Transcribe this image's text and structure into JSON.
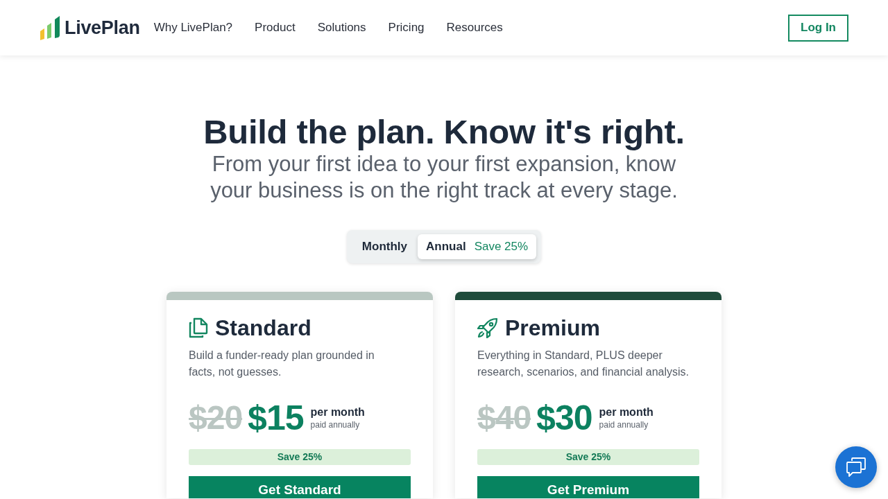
{
  "header": {
    "brand": "LivePlan",
    "nav": [
      "Why LivePlan?",
      "Product",
      "Solutions",
      "Pricing",
      "Resources"
    ],
    "login_button": "Log In"
  },
  "hero": {
    "title": "Build the plan. Know it's right.",
    "subtitle": "From your first idea to your first expansion, know your business is on the right track at every stage."
  },
  "billing_toggle": [
    {
      "label": "Monthly",
      "selected": false
    },
    {
      "label": "Annual",
      "note": "Save 25%",
      "selected": true
    }
  ],
  "plans": [
    {
      "kind": "standard",
      "color": "#b9c7c1",
      "name": "Standard",
      "description": "Build a funder-ready plan grounded in facts, not guesses.",
      "old_price": "$20",
      "price": "$15",
      "period": "per month",
      "billing": "paid annually",
      "savings": "Save 25%",
      "button": "Get Standard"
    },
    {
      "kind": "premium",
      "color": "#1f4b3b",
      "name": "Premium",
      "description": "Everything in Standard, PLUS deeper research, scenarios, and financial analysis.",
      "old_price": "$40",
      "price": "$30",
      "period": "per month",
      "billing": "paid annually",
      "savings": "Save 25%",
      "button": "Get Premium"
    }
  ]
}
